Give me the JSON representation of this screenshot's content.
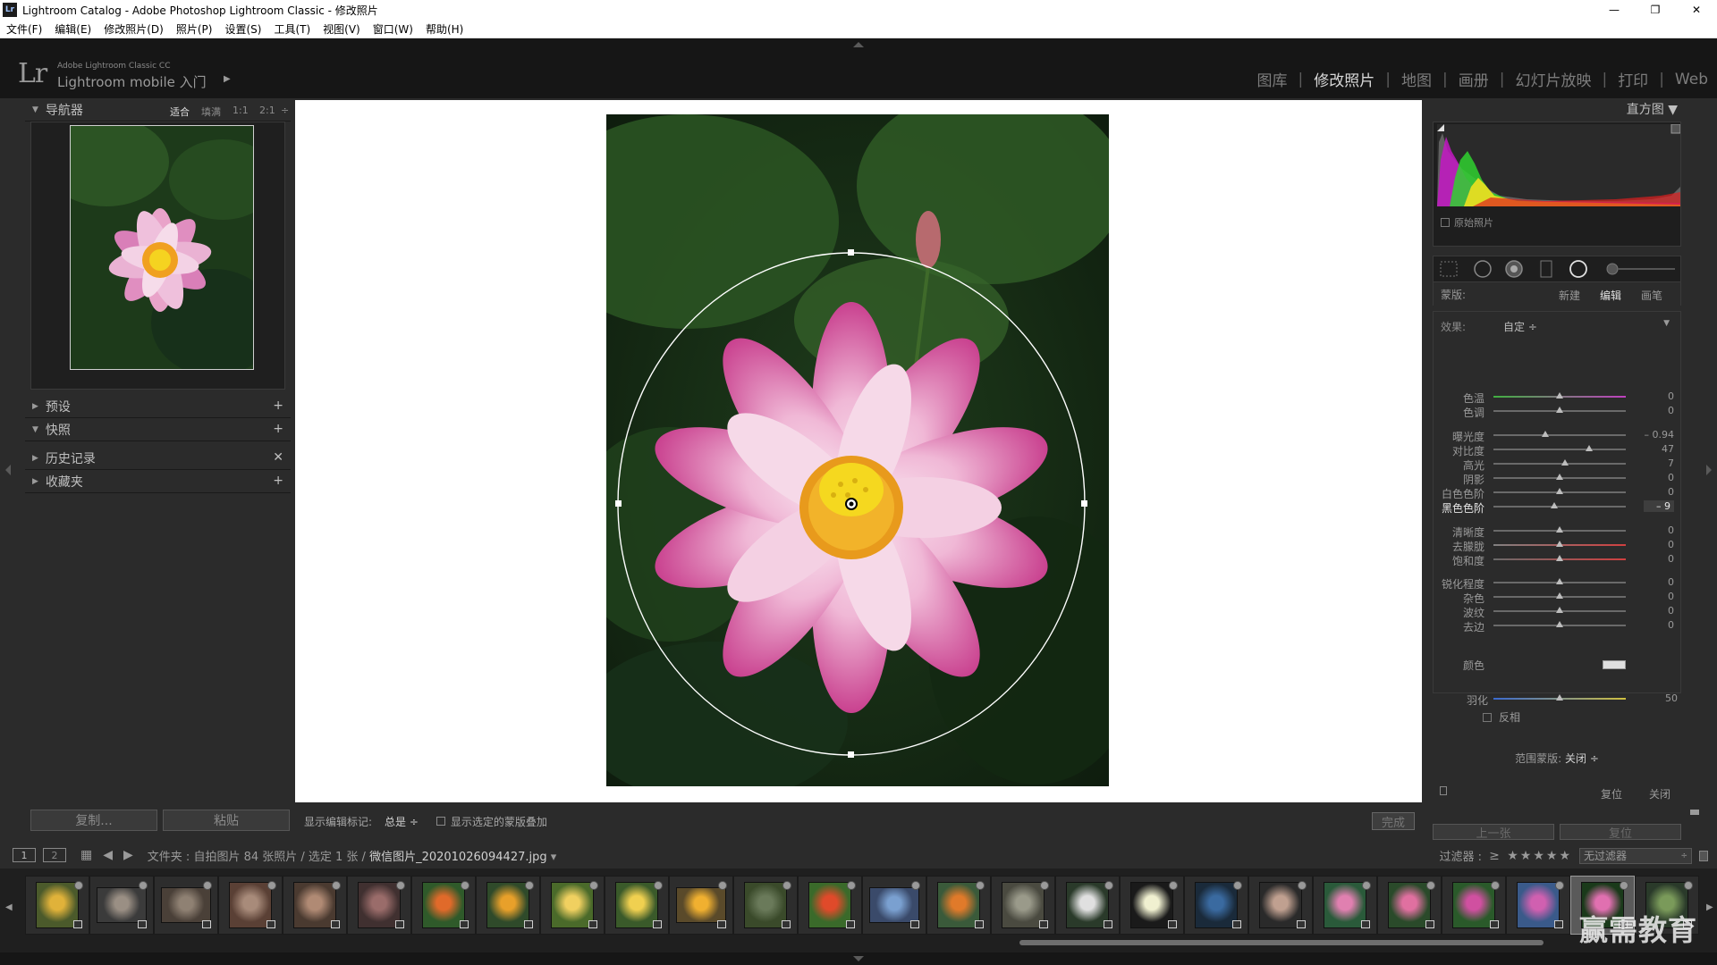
{
  "window": {
    "app_icon": "Lr",
    "title": "Lightroom Catalog - Adobe Photoshop Lightroom Classic - 修改照片",
    "minimize_icon": "—",
    "maximize_icon": "❐",
    "close_icon": "✕"
  },
  "menu": [
    "文件(F)",
    "编辑(E)",
    "修改照片(D)",
    "照片(P)",
    "设置(S)",
    "工具(T)",
    "视图(V)",
    "窗口(W)",
    "帮助(H)"
  ],
  "identity": {
    "logo": "Lr",
    "small": "Adobe Lightroom Classic CC",
    "main": "Lightroom mobile 入门",
    "arrow": "▶"
  },
  "modules": [
    {
      "label": "图库",
      "active": false
    },
    {
      "label": "修改照片",
      "active": true
    },
    {
      "label": "地图",
      "active": false
    },
    {
      "label": "画册",
      "active": false
    },
    {
      "label": "幻灯片放映",
      "active": false
    },
    {
      "label": "打印",
      "active": false
    },
    {
      "label": "Web",
      "active": false
    }
  ],
  "module_separator": "|",
  "left_panel": {
    "navigator": {
      "title": "导航器",
      "zoom": [
        "适合",
        "填满",
        "1:1",
        "2:1"
      ],
      "zoom_arrow": "÷"
    },
    "presets": {
      "title": "预设",
      "action": "+"
    },
    "snapshots": {
      "title": "快照",
      "action": "+"
    },
    "history": {
      "title": "历史记录",
      "action": "✕"
    },
    "collections": {
      "title": "收藏夹",
      "action": "+"
    },
    "copy_button": "复制...",
    "paste_button": "粘贴"
  },
  "toolbar": {
    "show_edit_pins_label": "显示编辑标记:",
    "show_edit_pins_value": "总是 ÷",
    "show_mask_overlay": "显示选定的蒙版叠加",
    "done_button": "完成"
  },
  "right_panel": {
    "histogram_title": "直方图 ▼",
    "original_photo": "原始照片",
    "mask_label": "蒙版:",
    "mask_options": [
      {
        "label": "新建",
        "active": false
      },
      {
        "label": "编辑",
        "active": true
      },
      {
        "label": "画笔",
        "active": false
      }
    ],
    "effect_label": "效果:",
    "effect_value": "自定 ÷",
    "effect_tri": "▼",
    "sliders": [
      {
        "label": "色温",
        "value": "0",
        "pos": 0.5
      },
      {
        "label": "色调",
        "value": "0",
        "pos": 0.5
      },
      {
        "label": "曝光度",
        "value": "– 0.94",
        "pos": 0.39
      },
      {
        "label": "对比度",
        "value": "47",
        "pos": 0.72
      },
      {
        "label": "高光",
        "value": "7",
        "pos": 0.54
      },
      {
        "label": "阴影",
        "value": "0",
        "pos": 0.5
      },
      {
        "label": "白色色阶",
        "value": "0",
        "pos": 0.5
      },
      {
        "label": "黑色色阶",
        "value": "– 9",
        "pos": 0.46,
        "highlight": true
      },
      {
        "label": "清晰度",
        "value": "0",
        "pos": 0.5
      },
      {
        "label": "去朦胧",
        "value": "0",
        "pos": 0.5
      },
      {
        "label": "饱和度",
        "value": "0",
        "pos": 0.5
      },
      {
        "label": "锐化程度",
        "value": "0",
        "pos": 0.5
      },
      {
        "label": "杂色",
        "value": "0",
        "pos": 0.5
      },
      {
        "label": "波纹",
        "value": "0",
        "pos": 0.5
      },
      {
        "label": "去边",
        "value": "0",
        "pos": 0.5
      }
    ],
    "color_label": "颜色",
    "feather": {
      "label": "羽化",
      "value": "50",
      "pos": 0.5
    },
    "invert_label": "反相",
    "range_mask_label": "范围蒙版:",
    "range_mask_value": "关闭 ÷",
    "reset_label": "复位",
    "close_label": "关闭",
    "prev_button": "上一张",
    "reset_button": "复位"
  },
  "filmstrip_bar": {
    "monitor1": "1",
    "monitor2": "2",
    "grid_icon": "▦",
    "back_icon": "◀",
    "forward_icon": "▶",
    "breadcrumb": "文件夹 : 自拍图片    84 张照片 / 选定 1 张 / ",
    "filename": "微信图片_20201026094427.jpg",
    "filename_arrow": " ▾",
    "filter_label": "过滤器 :",
    "stars": "≥ ★★★★★",
    "filter_select": "无过滤器",
    "filter_select_arrow": "÷"
  },
  "watermark": "赢需教育",
  "colors": {
    "accent": "#d8d8d8",
    "panel_bg": "#2b2b2b",
    "top_bg": "#161616"
  },
  "thumbs": [
    {
      "c1": "#e0b23a",
      "c2": "#4b5a2b",
      "land": false
    },
    {
      "c1": "#9a8f84",
      "c2": "#3b3b3b",
      "land": true
    },
    {
      "c1": "#8f8173",
      "c2": "#4a4038",
      "land": true
    },
    {
      "c1": "#a88b7a",
      "c2": "#5a4035",
      "land": false
    },
    {
      "c1": "#b08a74",
      "c2": "#4a3a30",
      "land": false
    },
    {
      "c1": "#9a6c6a",
      "c2": "#403030",
      "land": false
    },
    {
      "c1": "#e06a2a",
      "c2": "#2f5a2a",
      "land": false
    },
    {
      "c1": "#e8a02a",
      "c2": "#2f4a2a",
      "land": false
    },
    {
      "c1": "#f0d060",
      "c2": "#4a6a2a",
      "land": false
    },
    {
      "c1": "#f0d050",
      "c2": "#3a5a2a",
      "land": false
    },
    {
      "c1": "#f0b030",
      "c2": "#5a4a2a",
      "land": true
    },
    {
      "c1": "#6a7a5a",
      "c2": "#3a4a2a",
      "land": false
    },
    {
      "c1": "#e04a2a",
      "c2": "#3a6a2a",
      "land": false
    },
    {
      "c1": "#7aa0d0",
      "c2": "#3a4a6a",
      "land": true
    },
    {
      "c1": "#e07a2a",
      "c2": "#3a5a3a",
      "land": false
    },
    {
      "c1": "#9a9a8a",
      "c2": "#4a4a40",
      "land": false
    },
    {
      "c1": "#e0e0e0",
      "c2": "#2a3a2a",
      "land": false
    },
    {
      "c1": "#f0f0d0",
      "c2": "#1a1a1a",
      "land": false
    },
    {
      "c1": "#3a6aa0",
      "c2": "#1a2a3a",
      "land": false
    },
    {
      "c1": "#c0a090",
      "c2": "#2a2a2a",
      "land": false
    },
    {
      "c1": "#e080b0",
      "c2": "#2a5a3a",
      "land": false
    },
    {
      "c1": "#e070a0",
      "c2": "#2a4a2a",
      "land": false
    },
    {
      "c1": "#d050a0",
      "c2": "#2a5a2a",
      "land": false
    },
    {
      "c1": "#d060b0",
      "c2": "#3a5a8a",
      "land": false
    },
    {
      "c1": "#e070b0",
      "c2": "#1a3a1a",
      "land": false,
      "selected": true
    },
    {
      "c1": "#7a9a5a",
      "c2": "#2a3a2a",
      "land": false
    }
  ]
}
